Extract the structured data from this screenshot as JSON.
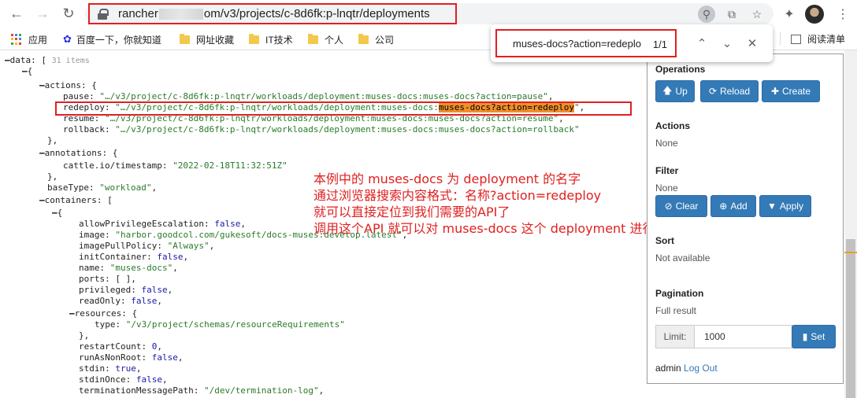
{
  "browser": {
    "url_host_prefix": "rancher",
    "url_host_suffix": "om",
    "url_path": "/v3/projects/c-8d6fk:p-lnqtr/deployments",
    "bookmarks": [
      "应用",
      "百度一下，你就知道",
      "网址收藏",
      "IT技术",
      "个人",
      "公司"
    ],
    "reading_list": "阅读清单",
    "find": {
      "query": "muses-docs?action=redeplo",
      "count": "1/1"
    },
    "icons": {
      "back": "back-arrow-icon",
      "forward": "forward-arrow-icon",
      "reload": "reload-icon",
      "lock": "lock-icon",
      "zoom": "search-zoom-icon",
      "share": "share-icon",
      "star": "star-icon",
      "extensions": "puzzle-icon",
      "menu": "more-vert-icon"
    }
  },
  "json": {
    "data_key": "data",
    "items_count": "31 items",
    "actions_key": "actions",
    "pause_key": "pause",
    "pause_val": "\"…/v3/project/c-8d6fk:p-lnqtr/workloads/deployment:muses-docs:muses-docs?action=pause\"",
    "redeploy_key": "redeploy",
    "redeploy_val_pre": "\"…/v3/project/c-8d6fk:p-lnqtr/workloads/deployment:muses-docs:",
    "redeploy_val_hl": "muses-docs?action=redeploy",
    "redeploy_val_post": "\"",
    "resume_key": "resume",
    "resume_val": "\"…/v3/project/c-8d6fk:p-lnqtr/workloads/deployment:muses-docs:muses-docs?action=resume\"",
    "rollback_key": "rollback",
    "rollback_val": "\"…/v3/project/c-8d6fk:p-lnqtr/workloads/deployment:muses-docs:muses-docs?action=rollback\"",
    "annotations_key": "annotations",
    "timestamp_key": "cattle.io/timestamp",
    "timestamp_val": "\"2022-02-18T11:32:51Z\"",
    "basetype_key": "baseType",
    "basetype_val": "\"workload\"",
    "containers_key": "containers",
    "ape_key": "allowPrivilegeEscalation",
    "ape_val": "false",
    "image_key": "image",
    "image_val": "\"harbor.goodcol.com/gukesoft/docs-muses:develop.latest\"",
    "ipp_key": "imagePullPolicy",
    "ipp_val": "\"Always\"",
    "init_key": "initContainer",
    "init_val": "false",
    "name_key": "name",
    "name_val": "\"muses-docs\"",
    "ports_key": "ports",
    "ports_val": "[ ]",
    "priv_key": "privileged",
    "priv_val": "false",
    "ro_key": "readOnly",
    "ro_val": "false",
    "resources_key": "resources",
    "type_key": "type",
    "type_val": "\"/v3/project/schemas/resourceRequirements\"",
    "restart_key": "restartCount",
    "restart_val": "0",
    "runas_key": "runAsNonRoot",
    "runas_val": "false",
    "stdin_key": "stdin",
    "stdin_val": "true",
    "stdinonce_key": "stdinOnce",
    "stdinonce_val": "false",
    "tmp_key": "terminationMessagePath",
    "tmp_val": "\"/dev/termination-log\""
  },
  "annotation_lines": [
    "本例中的 muses-docs 为 deployment 的名字",
    "通过浏览器搜索内容格式：名称?action=redeploy",
    "就可以直接定位到我们需要的API了",
    "调用这个API 就可以对 muses-docs 这个 deployment 进行重新部署"
  ],
  "panel": {
    "operations_title": "Operations",
    "up_label": "Up",
    "reload_label": "Reload",
    "create_label": "Create",
    "actions_title": "Actions",
    "actions_value": "None",
    "filter_title": "Filter",
    "filter_value": "None",
    "clear_label": "Clear",
    "add_label": "Add",
    "apply_label": "Apply",
    "sort_title": "Sort",
    "sort_value": "Not available",
    "pagination_title": "Pagination",
    "pagination_value": "Full result",
    "limit_label": "Limit:",
    "limit_value": "1000",
    "set_label": "Set",
    "footer_user": "admin",
    "footer_logout": "Log Out",
    "accent_color": "#337ab7"
  }
}
